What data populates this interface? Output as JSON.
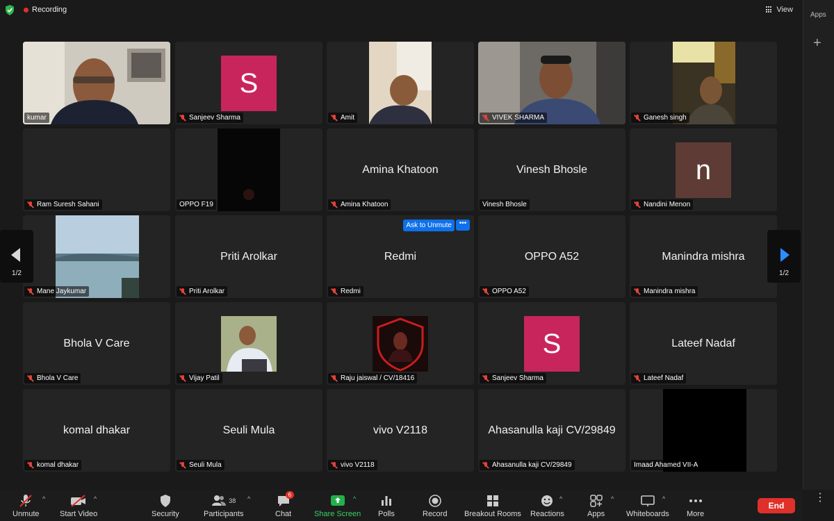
{
  "header": {
    "recording_label": "Recording",
    "view_label": "View"
  },
  "side_panel": {
    "apps_label": "Apps"
  },
  "pager": {
    "left_page": "1/2",
    "right_page": "1/2"
  },
  "tiles": [
    {
      "label": "kumar",
      "muted": false,
      "active": true,
      "display": "video"
    },
    {
      "label": "Sanjeev Sharma",
      "muted": true,
      "display": "avatar",
      "initial": "S",
      "avatar_color": "#c9255d"
    },
    {
      "label": "Amit",
      "muted": true,
      "display": "video"
    },
    {
      "label": "VIVEK SHARMA",
      "muted": true,
      "display": "video"
    },
    {
      "label": "Ganesh singh",
      "muted": true,
      "display": "video"
    },
    {
      "label": "Ram Suresh Sahani",
      "muted": true,
      "display": "blank"
    },
    {
      "label": "OPPO F19",
      "muted": false,
      "display": "video-dark"
    },
    {
      "label": "Amina Khatoon",
      "muted": true,
      "display": "name",
      "center_name": "Amina Khatoon"
    },
    {
      "label": "Vinesh Bhosle",
      "muted": false,
      "display": "name",
      "center_name": "Vinesh Bhosle"
    },
    {
      "label": "Nandini Menon",
      "muted": true,
      "display": "avatar",
      "initial": "n",
      "avatar_color": "#5e3c35"
    },
    {
      "label": "Mane Jaykumar",
      "muted": true,
      "display": "video"
    },
    {
      "label": "Priti Arolkar",
      "muted": true,
      "display": "name",
      "center_name": "Priti Arolkar"
    },
    {
      "label": "Redmi",
      "muted": true,
      "display": "name",
      "center_name": "Redmi",
      "ask_to_unmute": "Ask to Unmute",
      "more_label": "•••"
    },
    {
      "label": "OPPO A52",
      "muted": true,
      "display": "name",
      "center_name": "OPPO A52"
    },
    {
      "label": "Manindra mishra",
      "muted": true,
      "display": "name",
      "center_name": "Manindra mishra"
    },
    {
      "label": "Bhola V Care",
      "muted": true,
      "display": "name",
      "center_name": "Bhola V Care"
    },
    {
      "label": "Vijay Patil",
      "muted": true,
      "display": "video"
    },
    {
      "label": "Raju jaiswal / CV/18416",
      "muted": true,
      "display": "video"
    },
    {
      "label": "Sanjeev Sharma",
      "muted": true,
      "display": "avatar",
      "initial": "S",
      "avatar_color": "#c9255d"
    },
    {
      "label": "Lateef Nadaf",
      "muted": true,
      "display": "name",
      "center_name": "Lateef Nadaf"
    },
    {
      "label": "komal dhakar",
      "muted": true,
      "display": "name",
      "center_name": "komal dhakar"
    },
    {
      "label": "Seuli Mula",
      "muted": true,
      "display": "name",
      "center_name": "Seuli Mula"
    },
    {
      "label": "vivo V2118",
      "muted": true,
      "display": "name",
      "center_name": "vivo V2118"
    },
    {
      "label": "Ahasanulla kaji CV/29849",
      "muted": true,
      "display": "name",
      "center_name": "Ahasanulla kaji CV/29849"
    },
    {
      "label": "Imaad Ahamed VII-A",
      "muted": false,
      "display": "video-black"
    }
  ],
  "toolbar": {
    "unmute": "Unmute",
    "start_video": "Start Video",
    "security": "Security",
    "participants": "Participants",
    "participants_count": "38",
    "chat": "Chat",
    "chat_badge": "6",
    "share_screen": "Share Screen",
    "polls": "Polls",
    "record": "Record",
    "breakout_rooms": "Breakout Rooms",
    "reactions": "Reactions",
    "apps": "Apps",
    "whiteboards": "Whiteboards",
    "more": "More",
    "end": "End"
  },
  "colors": {
    "accent": "#0e71eb",
    "active_border": "#34c24a",
    "end_red": "#e0302a",
    "share_green": "#23b04b"
  }
}
